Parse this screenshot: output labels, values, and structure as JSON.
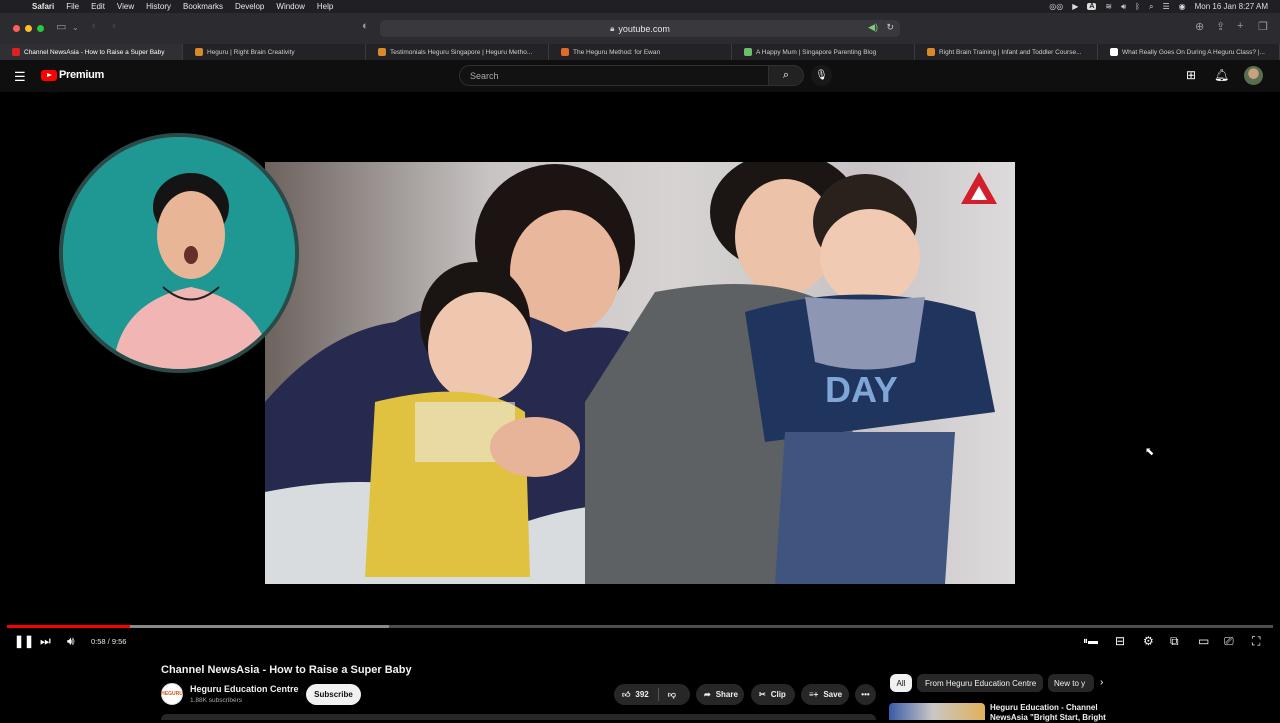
{
  "menubar": {
    "app": "Safari",
    "items": [
      "File",
      "Edit",
      "View",
      "History",
      "Bookmarks",
      "Develop",
      "Window",
      "Help"
    ],
    "datetime": "Mon 16 Jan  8:27 AM",
    "input_source": "A"
  },
  "browser": {
    "url": "youtube.com",
    "tabs": [
      {
        "label": "Channel NewsAsia - How to Raise a Super Baby",
        "favicon_color": "#e02020"
      },
      {
        "label": "Heguru | Right Brain Creativity",
        "favicon_color": "#d88a2a"
      },
      {
        "label": "Testimonials Heguru Singapore | Heguru Metho...",
        "favicon_color": "#d88a2a"
      },
      {
        "label": "The Heguru Method: for Ewan",
        "favicon_color": "#e06a2a"
      },
      {
        "label": "A Happy Mum | Singapore Parenting Blog",
        "favicon_color": "#6bbf6b"
      },
      {
        "label": "Right Brain Training | Infant and Toddler Course...",
        "favicon_color": "#d88a2a"
      },
      {
        "label": "What Really Goes On During A Heguru Class? |...",
        "favicon_color": "#ffffff"
      }
    ]
  },
  "masthead": {
    "logo_text": "Premium",
    "search_placeholder": "Search"
  },
  "player": {
    "current_time": "0:58",
    "duration": "9:56",
    "time_display": "0:58 / 9:56",
    "progress_fraction": 0.097,
    "buffered_fraction": 0.302
  },
  "video": {
    "title": "Channel NewsAsia - How to Raise a Super Baby",
    "channel_name": "Heguru Education Centre",
    "channel_avatar_text": "HEGURU",
    "subscribers": "1.88K subscribers",
    "subscribe_label": "Subscribe",
    "likes": "392",
    "share_label": "Share",
    "clip_label": "Clip",
    "save_label": "Save"
  },
  "related": {
    "chips": [
      "All",
      "From Heguru Education Centre",
      "New to y"
    ],
    "first_item_title": "Heguru Education - Channel NewsAsia \"Bright Start, Bright"
  }
}
